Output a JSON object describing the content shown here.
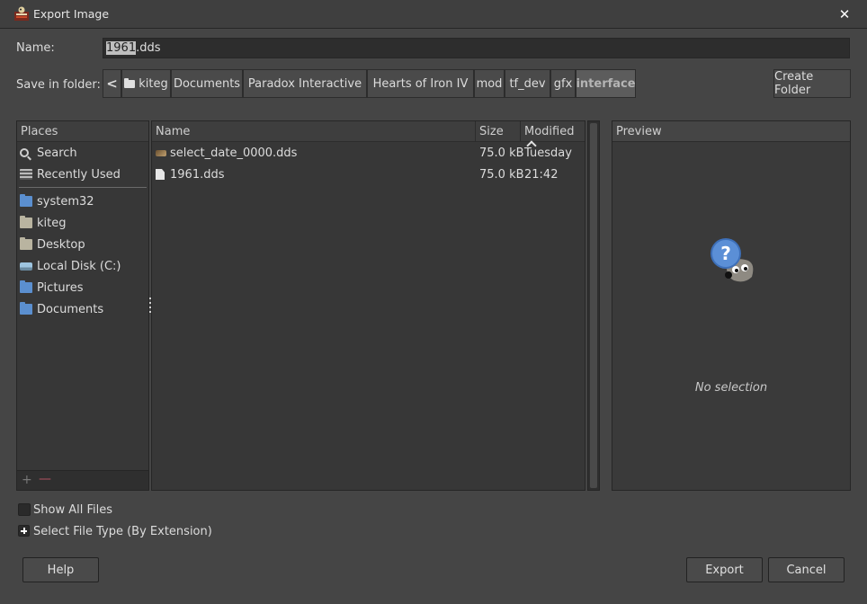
{
  "window": {
    "title": "Export Image"
  },
  "name_field": {
    "label": "Name:",
    "selected_text": "1961",
    "rest_text": ".dds"
  },
  "save_in": {
    "label": "Save in folder:",
    "back_glyph": "<",
    "breadcrumbs": [
      "kiteg",
      "Documents",
      "Paradox Interactive",
      "Hearts of Iron IV",
      "mod",
      "tf_dev",
      "gfx",
      "interface"
    ],
    "active_crumb": "interface"
  },
  "create_folder_label": "Create Folder",
  "places": {
    "header": "Places",
    "items": [
      {
        "label": "Search",
        "icon": "search-icon"
      },
      {
        "label": "Recently Used",
        "icon": "recent-icon"
      },
      {
        "label": "system32",
        "icon": "folder-icon"
      },
      {
        "label": "kiteg",
        "icon": "folder-icon"
      },
      {
        "label": "Desktop",
        "icon": "folder-icon"
      },
      {
        "label": "Local Disk (C:)",
        "icon": "drive-icon"
      },
      {
        "label": "Pictures",
        "icon": "folder-icon"
      },
      {
        "label": "Documents",
        "icon": "folder-icon"
      }
    ],
    "add_glyph": "+",
    "remove_glyph": "—"
  },
  "file_list": {
    "columns": {
      "name": "Name",
      "size": "Size",
      "modified": "Modified"
    },
    "sort": "modified-ascending",
    "files": [
      {
        "name": "select_date_0000.dds",
        "size": "75.0 kB",
        "modified": "Tuesday",
        "icon": "image-file-icon"
      },
      {
        "name": "1961.dds",
        "size": "75.0 kB",
        "modified": "21:42",
        "icon": "document-file-icon"
      }
    ]
  },
  "preview": {
    "header": "Preview",
    "empty_text": "No selection",
    "icon": "gimp-question-icon"
  },
  "options": {
    "show_all_files": "Show All Files",
    "show_all_checked": false,
    "select_file_type": "Select File Type (By Extension)"
  },
  "buttons": {
    "help": "Help",
    "export": "Export",
    "cancel": "Cancel"
  },
  "colors": {
    "background": "#454545",
    "panel": "#373737",
    "text": "#dcdcdc"
  }
}
